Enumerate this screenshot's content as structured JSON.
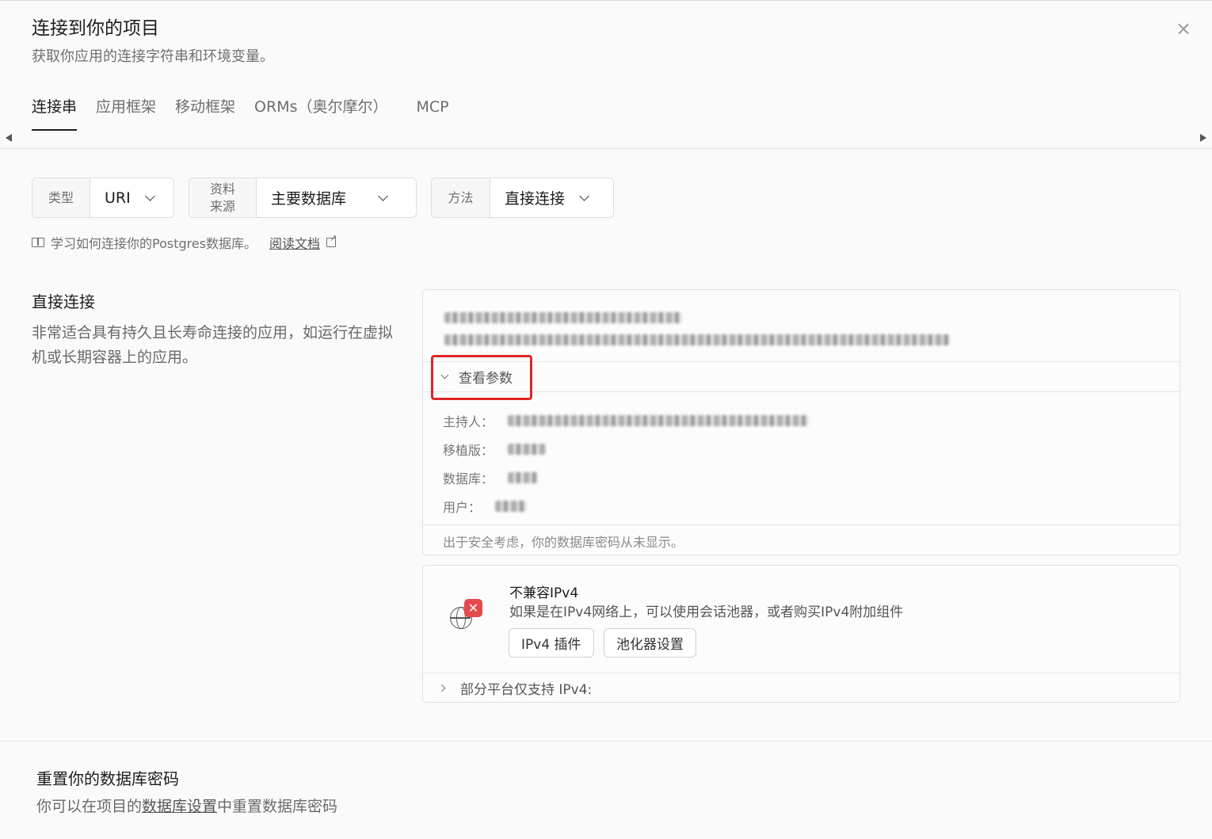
{
  "dialog": {
    "title": "连接到你的项目",
    "subtitle": "获取你应用的连接字符串和环境变量。"
  },
  "tabs": [
    {
      "label": "连接串",
      "active": true
    },
    {
      "label": "应用框架",
      "active": false
    },
    {
      "label": "移动框架",
      "active": false
    },
    {
      "label": "ORMs（奥尔摩尔）",
      "active": false
    },
    {
      "label": "MCP",
      "active": false
    }
  ],
  "selectors": {
    "type": {
      "label": "类型",
      "value": "URI"
    },
    "source": {
      "label_line1": "资料",
      "label_line2": "来源",
      "value": "主要数据库"
    },
    "method": {
      "label": "方法",
      "value": "直接连接"
    }
  },
  "learn": {
    "text": "学习如何连接你的Postgres数据库。",
    "link": "阅读文档"
  },
  "direct": {
    "title": "直接连接",
    "description": "非常适合具有持久且长寿命连接的应用，如运行在虚拟机或长期容器上的应用。"
  },
  "connection_card": {
    "view_params": "查看参数",
    "params": [
      {
        "label": "主持人："
      },
      {
        "label": "移植版："
      },
      {
        "label": "数据库："
      },
      {
        "label": "用户："
      }
    ],
    "footer": "出于安全考虑，你的数据库密码从未显示。"
  },
  "ipv4": {
    "title": "不兼容IPv4",
    "description": "如果是在IPv4网络上，可以使用会话池器，或者购买IPv4附加组件",
    "addon_button": "IPv4 插件",
    "pooler_button": "池化器设置",
    "platforms": "部分平台仅支持 IPv4:"
  },
  "reset": {
    "title": "重置你的数据库密码",
    "desc_prefix": "你可以在项目的",
    "desc_link": "数据库设置",
    "desc_suffix": "中重置数据库密码"
  },
  "colors": {
    "accent": "#1c1c1c",
    "highlight": "#e02424",
    "error_badge": "#e5484d"
  }
}
